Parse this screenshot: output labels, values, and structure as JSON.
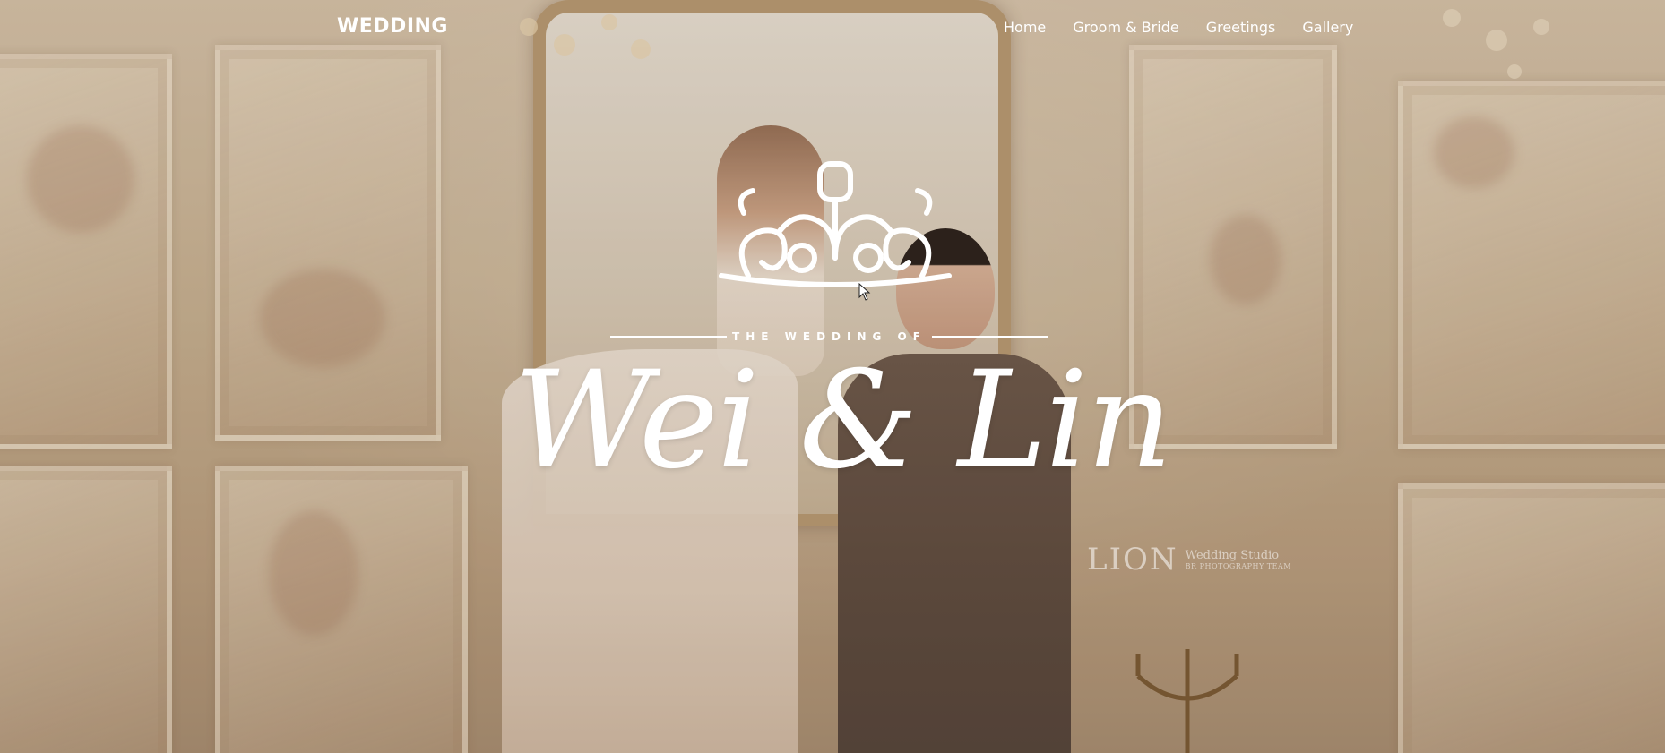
{
  "nav": {
    "brand": "WEDDING",
    "links": [
      "Home",
      "Groom & Bride",
      "Greetings",
      "Gallery"
    ]
  },
  "hero": {
    "subtitle": "THE WEDDING OF",
    "names": "Wei & Lin"
  },
  "watermark": {
    "brand": "LION",
    "line1": "Wedding Studio",
    "line2": "BR PHOTOGRAPHY TEAM"
  },
  "colors": {
    "text": "#ffffff",
    "wall": "#d6c3aa",
    "accent_frame": "#b89a73",
    "suit": "#5f4c40"
  },
  "icons": [
    "chandelier-ornament-icon",
    "mouse-cursor-icon"
  ]
}
